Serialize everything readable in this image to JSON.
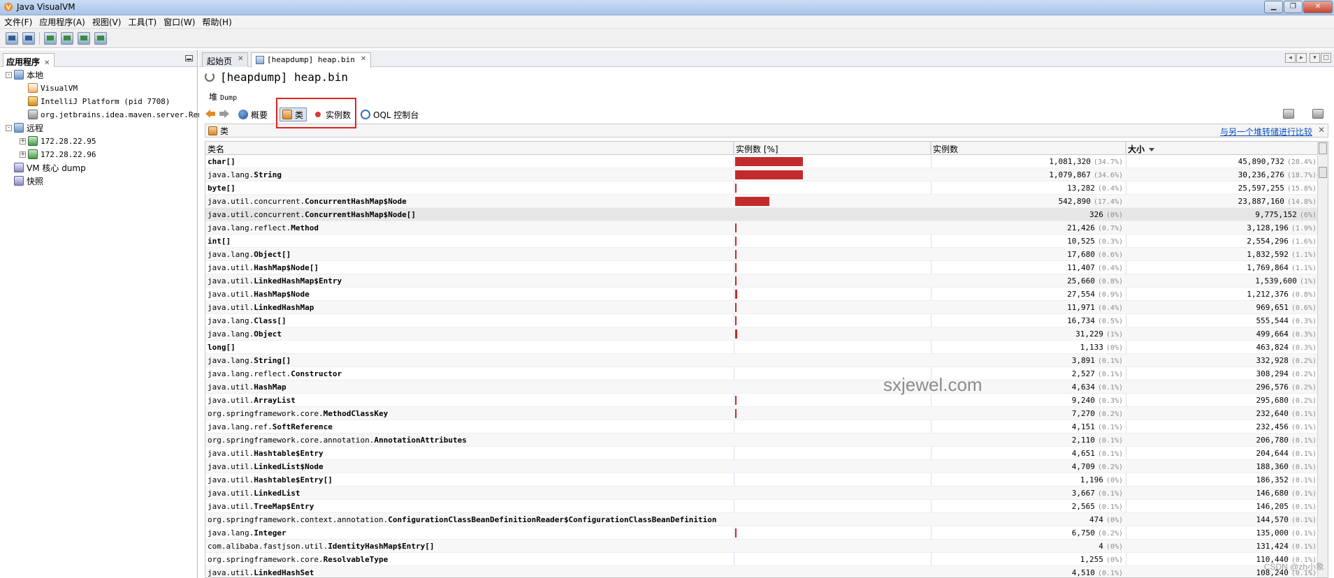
{
  "window": {
    "title": "Java VisualVM"
  },
  "menu": [
    "文件(F)",
    "应用程序(A)",
    "视图(V)",
    "工具(T)",
    "窗口(W)",
    "帮助(H)"
  ],
  "left_panel": {
    "tab": "应用程序",
    "tree": [
      {
        "label": "本地",
        "icon": "computer-icon",
        "level": 0,
        "expander": "-"
      },
      {
        "label": "VisualVM",
        "icon": "visualvm-icon",
        "level": 1,
        "mono": true
      },
      {
        "label": "IntelliJ Platform (pid 7708)",
        "icon": "intellij-icon",
        "level": 1,
        "mono": true
      },
      {
        "label": "org.jetbrains.idea.maven.server.Remo",
        "icon": "maven-server-icon",
        "level": 1,
        "mono": true
      },
      {
        "label": "远程",
        "icon": "network-icon",
        "level": 0,
        "expander": "-"
      },
      {
        "label": "172.28.22.95",
        "icon": "remote-host-icon",
        "level": 1,
        "expander": "+",
        "mono": true
      },
      {
        "label": "172.28.22.96",
        "icon": "remote-host-icon",
        "level": 1,
        "expander": "+",
        "mono": true
      },
      {
        "label": "VM 核心 dump",
        "icon": "core-dump-icon",
        "level": 0
      },
      {
        "label": "快照",
        "icon": "snapshot-icon",
        "level": 0
      }
    ]
  },
  "tabs": [
    {
      "label": "起始页"
    },
    {
      "label": "[heapdump] heap.bin"
    }
  ],
  "doc": {
    "title": "[heapdump] heap.bin",
    "section": "堆",
    "section_small": "Dump",
    "views": {
      "summary": "概要",
      "classes": "类",
      "instances": "实例数",
      "oql": "OQL 控制台"
    },
    "subheader": "类",
    "compare_link": "与另一个堆转储进行比较"
  },
  "table": {
    "columns": {
      "name": "类名",
      "bar": "实例数 [%]",
      "count": "实例数",
      "size": "大小"
    },
    "rows": [
      {
        "pkg": "",
        "cls": "char[]",
        "count": "1,081,320",
        "count_pct": "(34.7%)",
        "size": "45,890,732",
        "size_pct": "(28.4%)",
        "bar": 34.7
      },
      {
        "pkg": "java.lang.",
        "cls": "String",
        "count": "1,079,867",
        "count_pct": "(34.6%)",
        "size": "30,236,276",
        "size_pct": "(18.7%)",
        "bar": 34.6
      },
      {
        "pkg": "",
        "cls": "byte[]",
        "count": "13,282",
        "count_pct": "(0.4%)",
        "size": "25,597,255",
        "size_pct": "(15.8%)",
        "bar": 0.4
      },
      {
        "pkg": "java.util.concurrent.",
        "cls": "ConcurrentHashMap$Node",
        "count": "542,890",
        "count_pct": "(17.4%)",
        "size": "23,887,160",
        "size_pct": "(14.8%)",
        "bar": 17.4
      },
      {
        "pkg": "java.util.concurrent.",
        "cls": "ConcurrentHashMap$Node[]",
        "count": "326",
        "count_pct": "(0%)",
        "size": "9,775,152",
        "size_pct": "(6%)",
        "bar": 0
      },
      {
        "pkg": "java.lang.reflect.",
        "cls": "Method",
        "count": "21,426",
        "count_pct": "(0.7%)",
        "size": "3,128,196",
        "size_pct": "(1.9%)",
        "bar": 0.7
      },
      {
        "pkg": "",
        "cls": "int[]",
        "count": "10,525",
        "count_pct": "(0.3%)",
        "size": "2,554,296",
        "size_pct": "(1.6%)",
        "bar": 0.3
      },
      {
        "pkg": "java.lang.",
        "cls": "Object[]",
        "count": "17,680",
        "count_pct": "(0.6%)",
        "size": "1,832,592",
        "size_pct": "(1.1%)",
        "bar": 0.6
      },
      {
        "pkg": "java.util.",
        "cls": "HashMap$Node[]",
        "count": "11,407",
        "count_pct": "(0.4%)",
        "size": "1,769,864",
        "size_pct": "(1.1%)",
        "bar": 0.4
      },
      {
        "pkg": "java.util.",
        "cls": "LinkedHashMap$Entry",
        "count": "25,660",
        "count_pct": "(0.8%)",
        "size": "1,539,600",
        "size_pct": "(1%)",
        "bar": 0.8
      },
      {
        "pkg": "java.util.",
        "cls": "HashMap$Node",
        "count": "27,554",
        "count_pct": "(0.9%)",
        "size": "1,212,376",
        "size_pct": "(0.8%)",
        "bar": 0.9
      },
      {
        "pkg": "java.util.",
        "cls": "LinkedHashMap",
        "count": "11,971",
        "count_pct": "(0.4%)",
        "size": "969,651",
        "size_pct": "(0.6%)",
        "bar": 0.4
      },
      {
        "pkg": "java.lang.",
        "cls": "Class[]",
        "count": "16,734",
        "count_pct": "(0.5%)",
        "size": "555,544",
        "size_pct": "(0.3%)",
        "bar": 0.5
      },
      {
        "pkg": "java.lang.",
        "cls": "Object",
        "count": "31,229",
        "count_pct": "(1%)",
        "size": "499,664",
        "size_pct": "(0.3%)",
        "bar": 1.0
      },
      {
        "pkg": "",
        "cls": "long[]",
        "count": "1,133",
        "count_pct": "(0%)",
        "size": "463,824",
        "size_pct": "(0.3%)",
        "bar": 0
      },
      {
        "pkg": "java.lang.",
        "cls": "String[]",
        "count": "3,891",
        "count_pct": "(0.1%)",
        "size": "332,928",
        "size_pct": "(0.2%)",
        "bar": 0
      },
      {
        "pkg": "java.lang.reflect.",
        "cls": "Constructor",
        "count": "2,527",
        "count_pct": "(0.1%)",
        "size": "308,294",
        "size_pct": "(0.2%)",
        "bar": 0
      },
      {
        "pkg": "java.util.",
        "cls": "HashMap",
        "count": "4,634",
        "count_pct": "(0.1%)",
        "size": "296,576",
        "size_pct": "(0.2%)",
        "bar": 0
      },
      {
        "pkg": "java.util.",
        "cls": "ArrayList",
        "count": "9,240",
        "count_pct": "(0.3%)",
        "size": "295,680",
        "size_pct": "(0.2%)",
        "bar": 0.3
      },
      {
        "pkg": "org.springframework.core.",
        "cls": "MethodClassKey",
        "count": "7,270",
        "count_pct": "(0.2%)",
        "size": "232,640",
        "size_pct": "(0.1%)",
        "bar": 0.2
      },
      {
        "pkg": "java.lang.ref.",
        "cls": "SoftReference",
        "count": "4,151",
        "count_pct": "(0.1%)",
        "size": "232,456",
        "size_pct": "(0.1%)",
        "bar": 0
      },
      {
        "pkg": "org.springframework.core.annotation.",
        "cls": "AnnotationAttributes",
        "count": "2,110",
        "count_pct": "(0.1%)",
        "size": "206,780",
        "size_pct": "(0.1%)",
        "bar": 0
      },
      {
        "pkg": "java.util.",
        "cls": "Hashtable$Entry",
        "count": "4,651",
        "count_pct": "(0.1%)",
        "size": "204,644",
        "size_pct": "(0.1%)",
        "bar": 0
      },
      {
        "pkg": "java.util.",
        "cls": "LinkedList$Node",
        "count": "4,709",
        "count_pct": "(0.2%)",
        "size": "188,360",
        "size_pct": "(0.1%)",
        "bar": 0
      },
      {
        "pkg": "java.util.",
        "cls": "Hashtable$Entry[]",
        "count": "1,196",
        "count_pct": "(0%)",
        "size": "186,352",
        "size_pct": "(0.1%)",
        "bar": 0
      },
      {
        "pkg": "java.util.",
        "cls": "LinkedList",
        "count": "3,667",
        "count_pct": "(0.1%)",
        "size": "146,680",
        "size_pct": "(0.1%)",
        "bar": 0
      },
      {
        "pkg": "java.util.",
        "cls": "TreeMap$Entry",
        "count": "2,565",
        "count_pct": "(0.1%)",
        "size": "146,205",
        "size_pct": "(0.1%)",
        "bar": 0
      },
      {
        "pkg": "org.springframework.context.annotation.",
        "cls": "ConfigurationClassBeanDefinitionReader$ConfigurationClassBeanDefinition",
        "count": "474",
        "count_pct": "(0%)",
        "size": "144,570",
        "size_pct": "(0.1%)",
        "bar": 0
      },
      {
        "pkg": "java.lang.",
        "cls": "Integer",
        "count": "6,750",
        "count_pct": "(0.2%)",
        "size": "135,000",
        "size_pct": "(0.1%)",
        "bar": 0.2
      },
      {
        "pkg": "com.alibaba.fastjson.util.",
        "cls": "IdentityHashMap$Entry[]",
        "count": "4",
        "count_pct": "(0%)",
        "size": "131,424",
        "size_pct": "(0.1%)",
        "bar": 0
      },
      {
        "pkg": "org.springframework.core.",
        "cls": "ResolvableType",
        "count": "1,255",
        "count_pct": "(0%)",
        "size": "110,440",
        "size_pct": "(0.1%)",
        "bar": 0
      },
      {
        "pkg": "java.util.",
        "cls": "LinkedHashSet",
        "count": "4,510",
        "count_pct": "(0.1%)",
        "size": "108,240",
        "size_pct": "(0.1%)",
        "bar": 0
      }
    ]
  },
  "watermark": "sxjewel.com",
  "csdn_mark": "CSDN @zh小象"
}
